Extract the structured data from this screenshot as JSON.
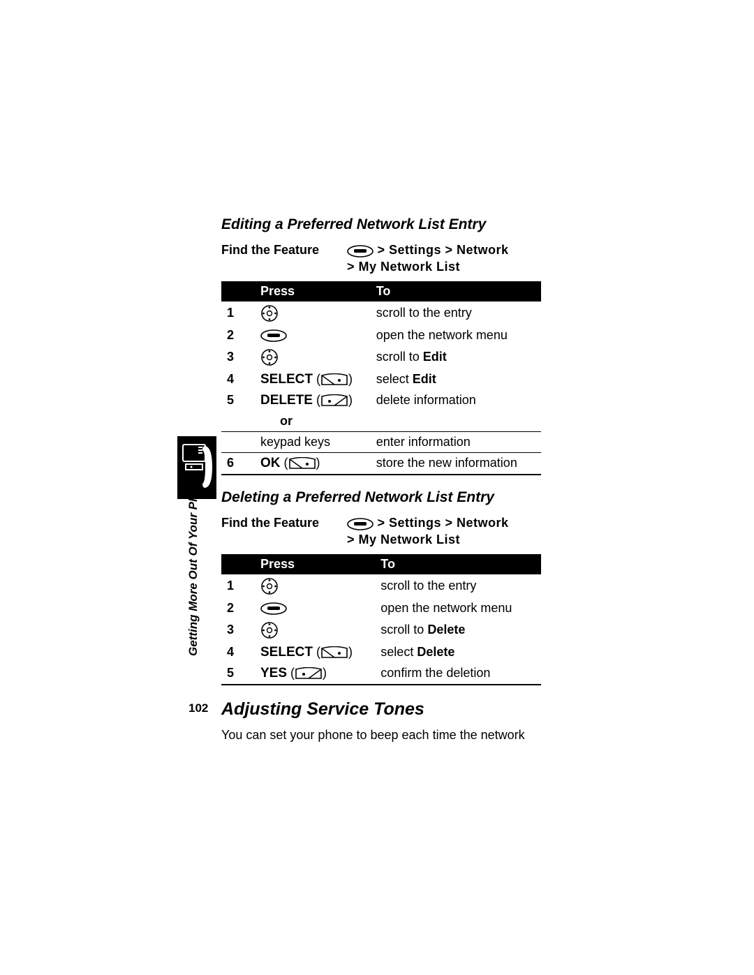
{
  "section1": {
    "heading": "Editing a Preferred Network List Entry",
    "ftf_label": "Find the Feature",
    "ftf_path_line1": "> Settings > Network",
    "ftf_path_line2": "> My Network List",
    "table": {
      "col_press": "Press",
      "col_to": "To",
      "rows": [
        {
          "num": "1",
          "press_type": "nav",
          "press_text": "",
          "key": "",
          "to_pre": "scroll to the entry",
          "to_mono": ""
        },
        {
          "num": "2",
          "press_type": "menu",
          "press_text": "",
          "key": "",
          "to_pre": "open the network menu",
          "to_mono": ""
        },
        {
          "num": "3",
          "press_type": "nav",
          "press_text": "",
          "key": "",
          "to_pre": "scroll to ",
          "to_mono": "Edit"
        },
        {
          "num": "4",
          "press_type": "label",
          "press_text": "SELECT",
          "key": "softright",
          "to_pre": "select ",
          "to_mono": "Edit"
        },
        {
          "num": "5",
          "press_type": "label",
          "press_text": "DELETE",
          "key": "softleft",
          "to_pre": "delete information",
          "to_mono": ""
        }
      ],
      "or_label": "or",
      "alt_row": {
        "press_text": "keypad keys",
        "to_pre": "enter information",
        "to_mono": ""
      },
      "row6": {
        "num": "6",
        "press_text": "OK",
        "key": "softright",
        "to_pre": "store the new information",
        "to_mono": ""
      }
    }
  },
  "section2": {
    "heading": "Deleting a Preferred Network List Entry",
    "ftf_label": "Find the Feature",
    "ftf_path_line1": "> Settings > Network",
    "ftf_path_line2": "> My Network List",
    "table": {
      "col_press": "Press",
      "col_to": "To",
      "rows": [
        {
          "num": "1",
          "press_type": "nav",
          "press_text": "",
          "key": "",
          "to_pre": "scroll to the entry",
          "to_mono": ""
        },
        {
          "num": "2",
          "press_type": "menu",
          "press_text": "",
          "key": "",
          "to_pre": "open the network menu",
          "to_mono": ""
        },
        {
          "num": "3",
          "press_type": "nav",
          "press_text": "",
          "key": "",
          "to_pre": "scroll to ",
          "to_mono": "Delete"
        },
        {
          "num": "4",
          "press_type": "label",
          "press_text": "SELECT",
          "key": "softright",
          "to_pre": "select ",
          "to_mono": "Delete"
        },
        {
          "num": "5",
          "press_type": "label",
          "press_text": "YES",
          "key": "softleft",
          "to_pre": "confirm the deletion",
          "to_mono": ""
        }
      ]
    }
  },
  "section3": {
    "heading": "Adjusting Service Tones",
    "para": "You can set your phone to beep each time the network"
  },
  "margin": {
    "vertical_label": "Getting More Out Of Your Phone",
    "page_number": "102"
  }
}
